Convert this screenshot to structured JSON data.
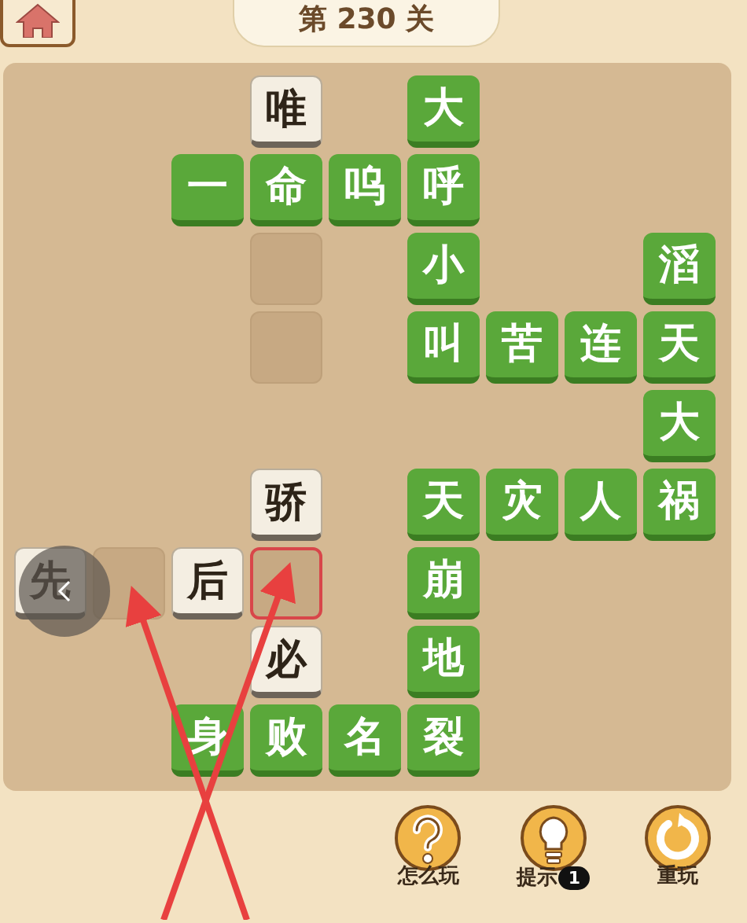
{
  "level_title": "第 230 关",
  "board": {
    "rows": [
      [
        {
          "kind": "blank"
        },
        {
          "kind": "blank"
        },
        {
          "kind": "blank"
        },
        {
          "kind": "given",
          "text": "唯"
        },
        {
          "kind": "blank"
        },
        {
          "kind": "solved",
          "text": "大"
        },
        {
          "kind": "blank"
        },
        {
          "kind": "blank"
        },
        {
          "kind": "blank"
        }
      ],
      [
        {
          "kind": "blank"
        },
        {
          "kind": "blank"
        },
        {
          "kind": "solved",
          "text": "一"
        },
        {
          "kind": "solved",
          "text": "命"
        },
        {
          "kind": "solved",
          "text": "呜"
        },
        {
          "kind": "solved",
          "text": "呼"
        },
        {
          "kind": "blank"
        },
        {
          "kind": "blank"
        },
        {
          "kind": "blank"
        }
      ],
      [
        {
          "kind": "blank"
        },
        {
          "kind": "blank"
        },
        {
          "kind": "blank"
        },
        {
          "kind": "slot",
          "selected": false
        },
        {
          "kind": "blank"
        },
        {
          "kind": "solved",
          "text": "小"
        },
        {
          "kind": "blank"
        },
        {
          "kind": "blank"
        },
        {
          "kind": "solved",
          "text": "滔"
        }
      ],
      [
        {
          "kind": "blank"
        },
        {
          "kind": "blank"
        },
        {
          "kind": "blank"
        },
        {
          "kind": "slot",
          "selected": false
        },
        {
          "kind": "blank"
        },
        {
          "kind": "solved",
          "text": "叫"
        },
        {
          "kind": "solved",
          "text": "苦"
        },
        {
          "kind": "solved",
          "text": "连"
        },
        {
          "kind": "solved",
          "text": "天"
        }
      ],
      [
        {
          "kind": "blank"
        },
        {
          "kind": "blank"
        },
        {
          "kind": "blank"
        },
        {
          "kind": "blank"
        },
        {
          "kind": "blank"
        },
        {
          "kind": "blank"
        },
        {
          "kind": "blank"
        },
        {
          "kind": "blank"
        },
        {
          "kind": "solved",
          "text": "大"
        }
      ],
      [
        {
          "kind": "blank"
        },
        {
          "kind": "blank"
        },
        {
          "kind": "blank"
        },
        {
          "kind": "given",
          "text": "骄"
        },
        {
          "kind": "blank"
        },
        {
          "kind": "solved",
          "text": "天"
        },
        {
          "kind": "solved",
          "text": "灾"
        },
        {
          "kind": "solved",
          "text": "人"
        },
        {
          "kind": "solved",
          "text": "祸"
        }
      ],
      [
        {
          "kind": "given",
          "text": "先"
        },
        {
          "kind": "slot",
          "selected": false
        },
        {
          "kind": "given",
          "text": "后"
        },
        {
          "kind": "slot",
          "selected": true
        },
        {
          "kind": "blank"
        },
        {
          "kind": "solved",
          "text": "崩"
        },
        {
          "kind": "blank"
        },
        {
          "kind": "blank"
        },
        {
          "kind": "blank"
        }
      ],
      [
        {
          "kind": "blank"
        },
        {
          "kind": "blank"
        },
        {
          "kind": "blank"
        },
        {
          "kind": "given",
          "text": "必"
        },
        {
          "kind": "blank"
        },
        {
          "kind": "solved",
          "text": "地"
        },
        {
          "kind": "blank"
        },
        {
          "kind": "blank"
        },
        {
          "kind": "blank"
        }
      ],
      [
        {
          "kind": "blank"
        },
        {
          "kind": "blank"
        },
        {
          "kind": "solved",
          "text": "身"
        },
        {
          "kind": "solved",
          "text": "败"
        },
        {
          "kind": "solved",
          "text": "名"
        },
        {
          "kind": "solved",
          "text": "裂"
        },
        {
          "kind": "blank"
        },
        {
          "kind": "blank"
        },
        {
          "kind": "blank"
        }
      ]
    ]
  },
  "actions": [
    {
      "kind": "help",
      "label": "怎么玩"
    },
    {
      "kind": "hint",
      "label": "提示",
      "badge": "1"
    },
    {
      "kind": "restart",
      "label": "重玩"
    }
  ]
}
